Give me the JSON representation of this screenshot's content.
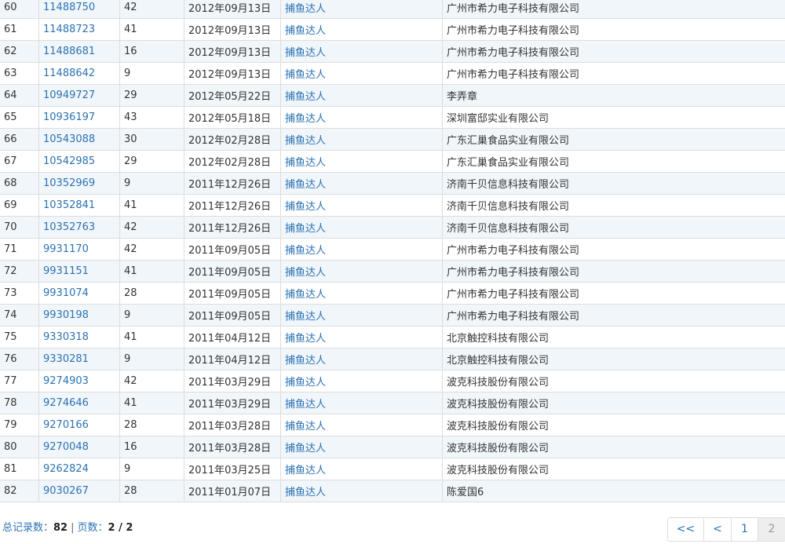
{
  "rows": [
    {
      "no": "60",
      "reg_no": "11488750",
      "class": "42",
      "date": "2012年09月13日",
      "name": "捕鱼达人",
      "applicant": "广州市希力电子科技有限公司"
    },
    {
      "no": "61",
      "reg_no": "11488723",
      "class": "41",
      "date": "2012年09月13日",
      "name": "捕鱼达人",
      "applicant": "广州市希力电子科技有限公司"
    },
    {
      "no": "62",
      "reg_no": "11488681",
      "class": "16",
      "date": "2012年09月13日",
      "name": "捕鱼达人",
      "applicant": "广州市希力电子科技有限公司"
    },
    {
      "no": "63",
      "reg_no": "11488642",
      "class": "9",
      "date": "2012年09月13日",
      "name": "捕鱼达人",
      "applicant": "广州市希力电子科技有限公司"
    },
    {
      "no": "64",
      "reg_no": "10949727",
      "class": "29",
      "date": "2012年05月22日",
      "name": "捕鱼达人",
      "applicant": "李弄章"
    },
    {
      "no": "65",
      "reg_no": "10936197",
      "class": "43",
      "date": "2012年05月18日",
      "name": "捕鱼达人",
      "applicant": "深圳富邸实业有限公司"
    },
    {
      "no": "66",
      "reg_no": "10543088",
      "class": "30",
      "date": "2012年02月28日",
      "name": "捕鱼达人",
      "applicant": "广东汇巢食品实业有限公司"
    },
    {
      "no": "67",
      "reg_no": "10542985",
      "class": "29",
      "date": "2012年02月28日",
      "name": "捕鱼达人",
      "applicant": "广东汇巢食品实业有限公司"
    },
    {
      "no": "68",
      "reg_no": "10352969",
      "class": "9",
      "date": "2011年12月26日",
      "name": "捕鱼达人",
      "applicant": "济南千贝信息科技有限公司"
    },
    {
      "no": "69",
      "reg_no": "10352841",
      "class": "41",
      "date": "2011年12月26日",
      "name": "捕鱼达人",
      "applicant": "济南千贝信息科技有限公司"
    },
    {
      "no": "70",
      "reg_no": "10352763",
      "class": "42",
      "date": "2011年12月26日",
      "name": "捕鱼达人",
      "applicant": "济南千贝信息科技有限公司"
    },
    {
      "no": "71",
      "reg_no": "9931170",
      "class": "42",
      "date": "2011年09月05日",
      "name": "捕鱼达人",
      "applicant": "广州市希力电子科技有限公司"
    },
    {
      "no": "72",
      "reg_no": "9931151",
      "class": "41",
      "date": "2011年09月05日",
      "name": "捕鱼达人",
      "applicant": "广州市希力电子科技有限公司"
    },
    {
      "no": "73",
      "reg_no": "9931074",
      "class": "28",
      "date": "2011年09月05日",
      "name": "捕鱼达人",
      "applicant": "广州市希力电子科技有限公司"
    },
    {
      "no": "74",
      "reg_no": "9930198",
      "class": "9",
      "date": "2011年09月05日",
      "name": "捕鱼达人",
      "applicant": "广州市希力电子科技有限公司"
    },
    {
      "no": "75",
      "reg_no": "9330318",
      "class": "41",
      "date": "2011年04月12日",
      "name": "捕鱼达人",
      "applicant": "北京触控科技有限公司"
    },
    {
      "no": "76",
      "reg_no": "9330281",
      "class": "9",
      "date": "2011年04月12日",
      "name": "捕鱼达人",
      "applicant": "北京触控科技有限公司"
    },
    {
      "no": "77",
      "reg_no": "9274903",
      "class": "42",
      "date": "2011年03月29日",
      "name": "捕鱼达人",
      "applicant": "波克科技股份有限公司"
    },
    {
      "no": "78",
      "reg_no": "9274646",
      "class": "41",
      "date": "2011年03月29日",
      "name": "捕鱼达人",
      "applicant": "波克科技股份有限公司"
    },
    {
      "no": "79",
      "reg_no": "9270166",
      "class": "28",
      "date": "2011年03月28日",
      "name": "捕鱼达人",
      "applicant": "波克科技股份有限公司"
    },
    {
      "no": "80",
      "reg_no": "9270048",
      "class": "16",
      "date": "2011年03月28日",
      "name": "捕鱼达人",
      "applicant": "波克科技股份有限公司"
    },
    {
      "no": "81",
      "reg_no": "9262824",
      "class": "9",
      "date": "2011年03月25日",
      "name": "捕鱼达人",
      "applicant": "波克科技股份有限公司"
    },
    {
      "no": "82",
      "reg_no": "9030267",
      "class": "28",
      "date": "2011年01月07日",
      "name": "捕鱼达人",
      "applicant": "陈爱国6"
    }
  ],
  "summary": {
    "total_label": "总记录数：",
    "total_value": "82",
    "separator": "|",
    "pages_label": "页数：",
    "pages_value": "2 / 2"
  },
  "pager": {
    "first": "<<",
    "prev": "<",
    "page1": "1",
    "page2": "2"
  },
  "colors": {
    "link": "#2a72b2",
    "row_alt": "#f1f6fb",
    "border": "#dddddd"
  }
}
